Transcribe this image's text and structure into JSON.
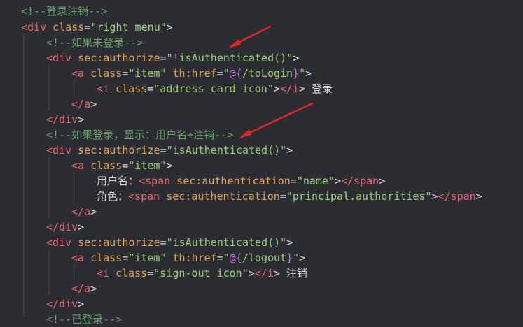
{
  "code": {
    "l1": {
      "c": "<!--登录注销-->"
    },
    "l2": {
      "t1": "<div",
      "a1": "class",
      "eq": "=",
      "s1": "\"right menu\"",
      "gt": ">"
    },
    "l3": {
      "c": "<!--如果未登录-->"
    },
    "l4": {
      "t1": "<div",
      "a1": "sec:authorize",
      "eq": "=",
      "s1q": "\"",
      "x1": "!",
      "s1": "isAuthenticated()",
      "s1e": "\"",
      "gt": ">"
    },
    "l5": {
      "t1": "<a",
      "a1": "class",
      "eq1": "=",
      "s1": "\"item\"",
      "a2": "th:href",
      "eq2": "=",
      "s2q": "\"",
      "x1": "@{",
      "s2": "/toLogin",
      "x2": "}",
      "s2e": "\"",
      "gt": ">"
    },
    "l6": {
      "t1": "<i",
      "a1": "class",
      "eq": "=",
      "s1": "\"address card icon\"",
      "gt": ">",
      "t2": "</i",
      "gt2": ">",
      "text": " 登录"
    },
    "l7": {
      "t1": "</a",
      "gt": ">"
    },
    "l8": {
      "t1": "</div",
      "gt": ">"
    },
    "l9": {
      "c": "<!--如果登录，显示：用户名+注销-->"
    },
    "l10": {
      "t1": "<div",
      "a1": "sec:authorize",
      "eq": "=",
      "s1": "\"isAuthenticated()\"",
      "gt": ">"
    },
    "l11": {
      "t1": "<a",
      "a1": "class",
      "eq": "=",
      "s1": "\"item\"",
      "gt": ">"
    },
    "l12": {
      "text": "用户名：",
      "t1": "<span",
      "a1": "sec:authentication",
      "eq": "=",
      "s1": "\"name\"",
      "gt": ">",
      "t2": "</span",
      "gt2": ">"
    },
    "l13": {
      "text": "角色：",
      "t1": "<span",
      "a1": "sec:authentication",
      "eq": "=",
      "s1": "\"principal.authorities\"",
      "gt": ">",
      "t2": "</span",
      "gt2": ">"
    },
    "l14": {
      "t1": "</a",
      "gt": ">"
    },
    "l15": {
      "t1": "</div",
      "gt": ">"
    },
    "l16": {
      "t1": "<div",
      "a1": "sec:authorize",
      "eq": "=",
      "s1": "\"isAuthenticated()\"",
      "gt": ">"
    },
    "l17": {
      "t1": "<a",
      "a1": "class",
      "eq1": "=",
      "s1": "\"item\"",
      "a2": "th:href",
      "eq2": "=",
      "s2q": "\"",
      "x1": "@{",
      "s2": "/logout",
      "x2": "}",
      "s2e": "\"",
      "gt": ">"
    },
    "l18": {
      "t1": "<i",
      "a1": "class",
      "eq": "=",
      "s1": "\"sign-out icon\"",
      "gt": ">",
      "t2": "</i",
      "gt2": ">",
      "text": " 注销"
    },
    "l19": {
      "t1": "</a",
      "gt": ">"
    },
    "l20": {
      "t1": "</div",
      "gt": ">"
    },
    "l21": {
      "c": "<!--已登录-->"
    }
  },
  "colors": {
    "background": "#2b2d32",
    "comment": "#6aa36f",
    "tag": "#e8676f",
    "attribute": "#e0a35a",
    "string": "#9ccf78",
    "annotation_arrow": "#e0262b"
  }
}
